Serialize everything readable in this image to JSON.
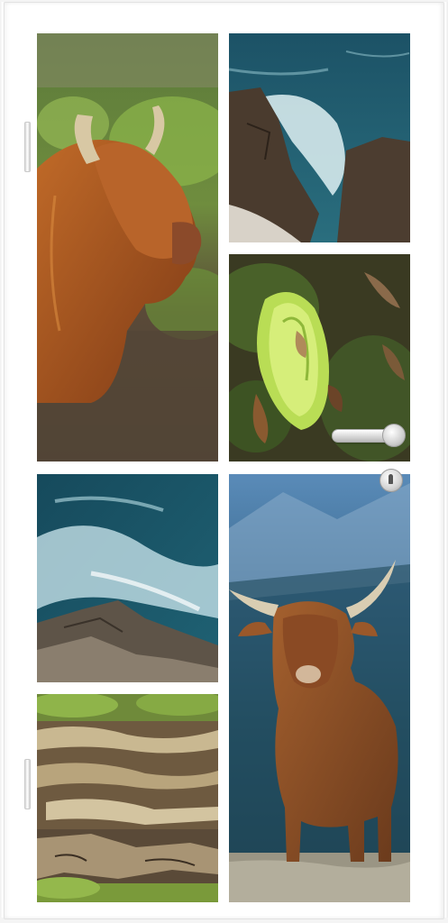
{
  "scene": {
    "type": "photo door mural",
    "panels": [
      {
        "subject": "highland-cow-side"
      },
      {
        "subject": "sea-cliff-waves"
      },
      {
        "subject": "green-bracket-fungus"
      },
      {
        "subject": "crashing-waves-rocks"
      },
      {
        "subject": "highland-cow-front"
      },
      {
        "subject": "layered-tree-fungus"
      }
    ]
  },
  "colors": {
    "door": "#ffffff",
    "cow_fur": "#a4521e",
    "sea": "#1f5a6a",
    "moss": "#7aa93a"
  },
  "icons": {
    "handle": "door-handle-icon",
    "lock": "keyhole-icon"
  }
}
